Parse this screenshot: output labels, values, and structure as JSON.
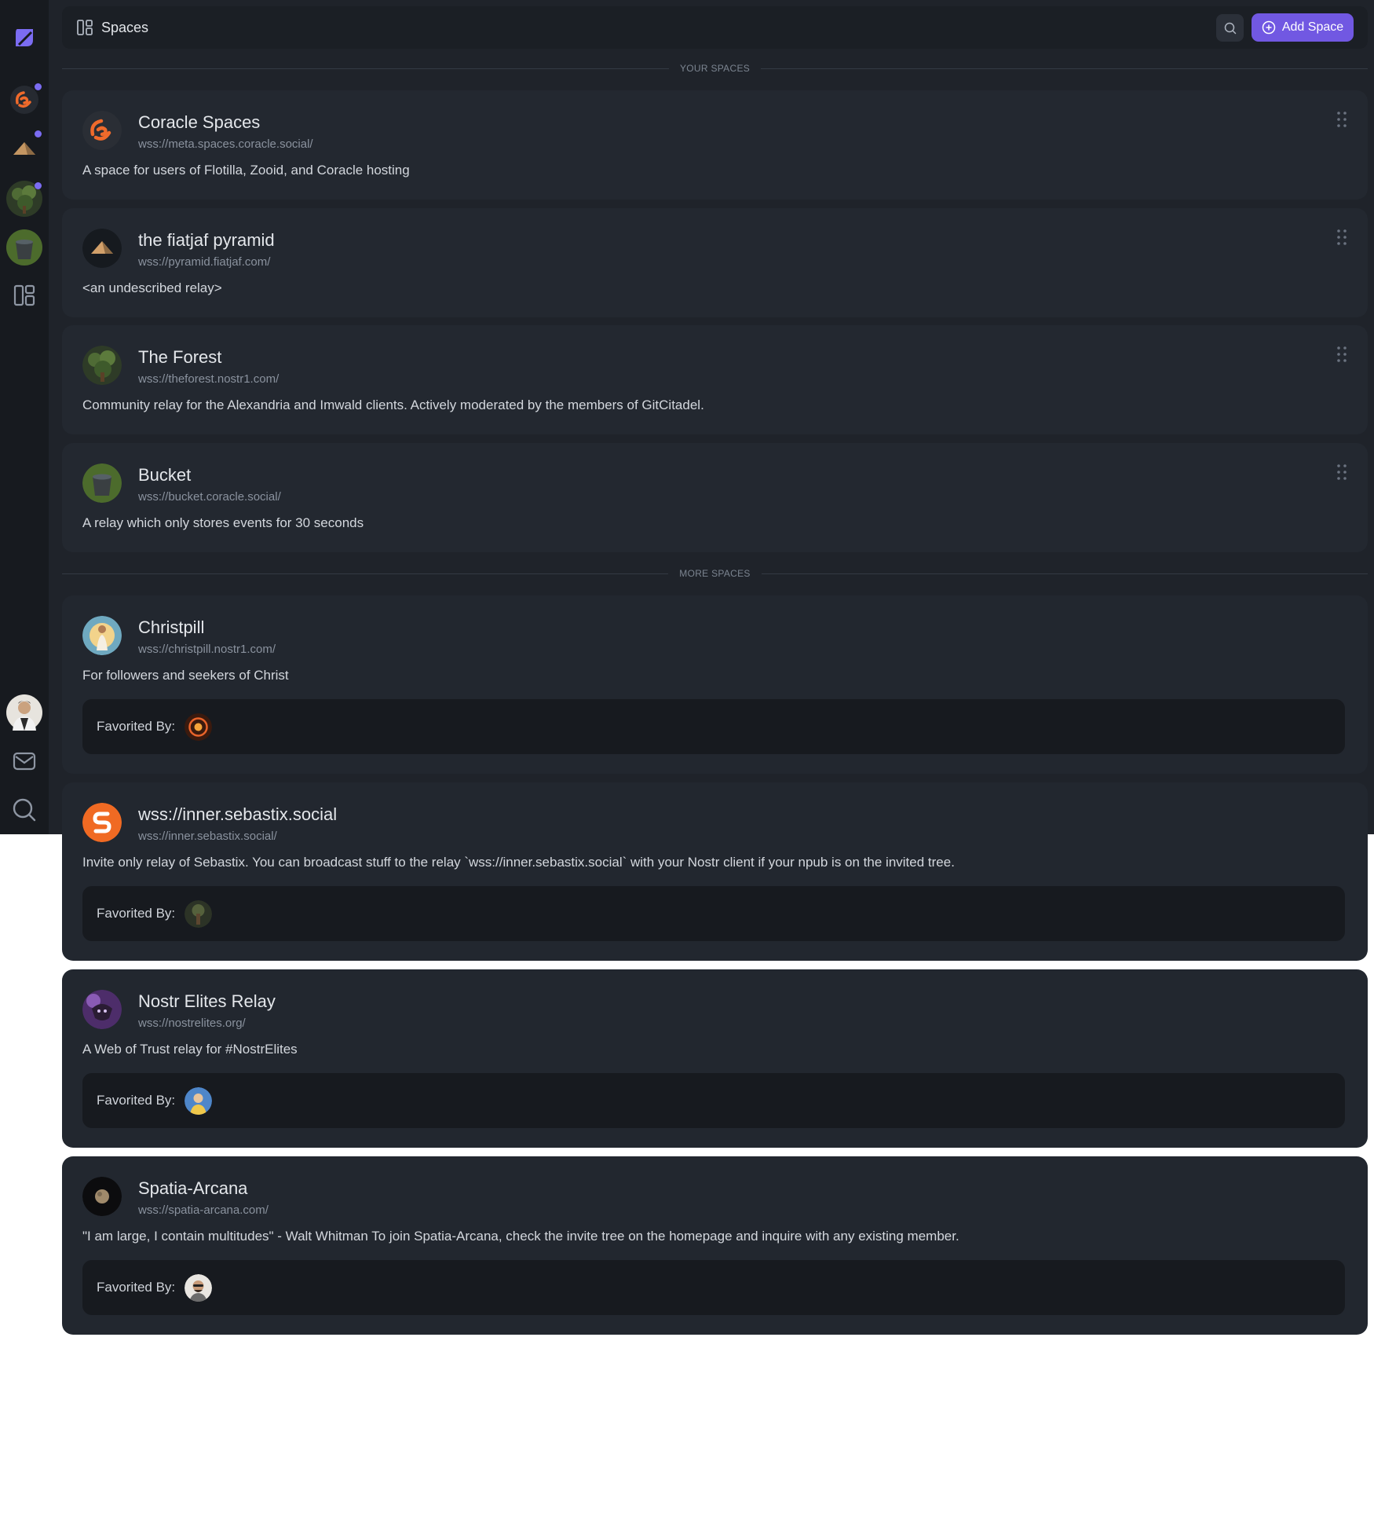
{
  "header": {
    "title": "Spaces",
    "add_space_label": "Add Space"
  },
  "sections": {
    "your_spaces": "YOUR SPACES",
    "more_spaces": "MORE SPACES"
  },
  "your_spaces": [
    {
      "name": "Coracle Spaces",
      "url": "wss://meta.spaces.coracle.social/",
      "description": "A space for users of Flotilla, Zooid, and Coracle hosting"
    },
    {
      "name": "the fiatjaf pyramid",
      "url": "wss://pyramid.fiatjaf.com/",
      "description": "<an undescribed relay>"
    },
    {
      "name": "The Forest",
      "url": "wss://theforest.nostr1.com/",
      "description": "Community relay for the Alexandria and Imwald clients. Actively moderated by the members of GitCitadel."
    },
    {
      "name": "Bucket",
      "url": "wss://bucket.coracle.social/",
      "description": "A relay which only stores events for 30 seconds"
    }
  ],
  "more_spaces": [
    {
      "name": "Christpill",
      "url": "wss://christpill.nostr1.com/",
      "description": "For followers and seekers of Christ",
      "favorited_label": "Favorited By:"
    },
    {
      "name": "wss://inner.sebastix.social",
      "url": "wss://inner.sebastix.social/",
      "description": "Invite only relay of Sebastix. You can broadcast stuff to the relay `wss://inner.sebastix.social` with your Nostr client if your npub is on the invited tree.",
      "favorited_label": "Favorited By:"
    },
    {
      "name": "Nostr Elites Relay",
      "url": "wss://nostrelites.org/",
      "description": "A Web of Trust relay for #NostrElites",
      "favorited_label": "Favorited By:"
    },
    {
      "name": "Spatia-Arcana",
      "url": "wss://spatia-arcana.com/",
      "description": "\"I am large, I contain multitudes\" - Walt Whitman To join Spatia-Arcana, check the invite tree on the homepage and inquire with any existing member.",
      "favorited_label": "Favorited By:"
    }
  ],
  "colors": {
    "accent": "#7158e2",
    "background": "#1f232a",
    "sidebar": "#171a1f",
    "card": "#232830",
    "notification_dot": "#7b6cf2"
  }
}
